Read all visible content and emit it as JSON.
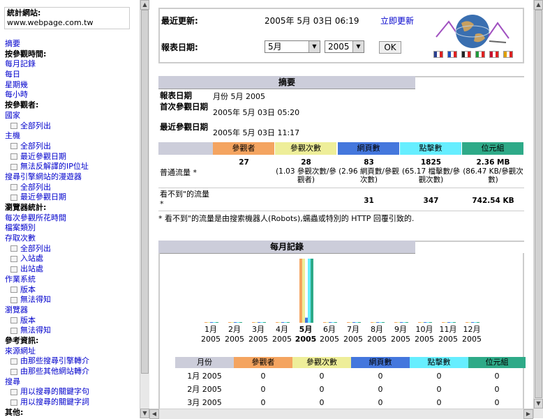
{
  "left": {
    "title": "統計網站:",
    "site": "www.webpage.com.tw",
    "nav": [
      {
        "type": "link",
        "label": "摘要",
        "name": "nav-summary"
      },
      {
        "type": "head",
        "label": "按參觀時間:",
        "name": "nav-head-time"
      },
      {
        "type": "link",
        "label": "每月記錄",
        "name": "nav-monthly"
      },
      {
        "type": "link",
        "label": "每日",
        "name": "nav-daily"
      },
      {
        "type": "link",
        "label": "星期幾",
        "name": "nav-weekday"
      },
      {
        "type": "link",
        "label": "每小時",
        "name": "nav-hourly"
      },
      {
        "type": "head",
        "label": "按參觀者:",
        "name": "nav-head-visitors"
      },
      {
        "type": "link",
        "label": "國家",
        "name": "nav-country"
      },
      {
        "type": "sub",
        "label": "全部列出",
        "name": "nav-country-all"
      },
      {
        "type": "link",
        "label": "主機",
        "name": "nav-hosts"
      },
      {
        "type": "sub",
        "label": "全部列出",
        "name": "nav-hosts-all"
      },
      {
        "type": "sub",
        "label": "最近參觀日期",
        "name": "nav-hosts-last"
      },
      {
        "type": "sub",
        "label": "無法反解譯的IP位址",
        "name": "nav-hosts-unresolved"
      },
      {
        "type": "link",
        "label": "搜尋引擎網站的漫遊器",
        "name": "nav-robots"
      },
      {
        "type": "sub",
        "label": "全部列出",
        "name": "nav-robots-all"
      },
      {
        "type": "sub",
        "label": "最近參觀日期",
        "name": "nav-robots-last"
      },
      {
        "type": "head",
        "label": "瀏覽器統計:",
        "name": "nav-head-browse"
      },
      {
        "type": "link",
        "label": "每次參觀所花時間",
        "name": "nav-duration"
      },
      {
        "type": "link",
        "label": "檔案類別",
        "name": "nav-filetypes"
      },
      {
        "type": "link",
        "label": "存取次數",
        "name": "nav-access"
      },
      {
        "type": "sub",
        "label": "全部列出",
        "name": "nav-access-all"
      },
      {
        "type": "sub",
        "label": "入站處",
        "name": "nav-entry"
      },
      {
        "type": "sub",
        "label": "出站處",
        "name": "nav-exit"
      },
      {
        "type": "link",
        "label": "作業系統",
        "name": "nav-os"
      },
      {
        "type": "sub",
        "label": "版本",
        "name": "nav-os-version"
      },
      {
        "type": "sub",
        "label": "無法得知",
        "name": "nav-os-unknown"
      },
      {
        "type": "link",
        "label": "瀏覽器",
        "name": "nav-browser"
      },
      {
        "type": "sub",
        "label": "版本",
        "name": "nav-browser-version"
      },
      {
        "type": "sub",
        "label": "無法得知",
        "name": "nav-browser-unknown"
      },
      {
        "type": "head",
        "label": "參考資訊:",
        "name": "nav-head-refs"
      },
      {
        "type": "link",
        "label": "來源網址",
        "name": "nav-referrer"
      },
      {
        "type": "sub",
        "label": "由那些搜尋引擎轉介",
        "name": "nav-ref-engines"
      },
      {
        "type": "sub",
        "label": "由那些其他網站轉介",
        "name": "nav-ref-sites"
      },
      {
        "type": "link",
        "label": "搜尋",
        "name": "nav-search"
      },
      {
        "type": "sub",
        "label": "用以搜尋的關鍵字句",
        "name": "nav-keyphrases"
      },
      {
        "type": "sub",
        "label": "用以搜尋的關鍵字詞",
        "name": "nav-keywords"
      },
      {
        "type": "head",
        "label": "其他:",
        "name": "nav-head-other"
      }
    ]
  },
  "top": {
    "last_update_label": "最近更新:",
    "last_update_value": "2005年 5月 03日 06:19",
    "update_now": "立即更新",
    "report_date_label": "報表日期:",
    "month_select": "5月",
    "year_select": "2005",
    "ok": "OK"
  },
  "flags": [
    {
      "name": "flag-uk-icon",
      "color": "#2a3f8f"
    },
    {
      "name": "flag-fr-icon",
      "color": "#1d4fbf"
    },
    {
      "name": "flag-de-icon",
      "color": "#222222"
    },
    {
      "name": "flag-it-icon",
      "color": "#1e9a3a"
    },
    {
      "name": "flag-nl-icon",
      "color": "#c8102e"
    },
    {
      "name": "flag-es-icon",
      "color": "#e0a000"
    }
  ],
  "summary": {
    "title": "摘要",
    "report_date_label": "報表日期",
    "report_date_value": "月份 5月 2005",
    "first_visit_label": "首次參觀日期",
    "first_visit_value": "2005年 5月 03日 05:20",
    "last_visit_label": "最近參觀日期",
    "last_visit_value": "2005年 5月 03日 11:17",
    "columns": [
      {
        "label": "參觀者",
        "color": "#f4a460"
      },
      {
        "label": "參觀次數",
        "color": "#eeee99"
      },
      {
        "label": "網頁數",
        "color": "#4477dd"
      },
      {
        "label": "點擊數",
        "color": "#66eeff"
      },
      {
        "label": "位元組",
        "color": "#2eaa88"
      }
    ],
    "traffic_label": "普通流量 *",
    "traffic": [
      {
        "main": "27",
        "sub": ""
      },
      {
        "main": "28",
        "sub": "(1.03 參觀次數/參觀者)"
      },
      {
        "main": "83",
        "sub": "(2.96 網頁數/參觀次數)"
      },
      {
        "main": "1825",
        "sub": "(65.17 檔擊數/參觀次數)"
      },
      {
        "main": "2.36 MB",
        "sub": "(86.47 KB/參觀次數)"
      }
    ],
    "unseen_label": "看不到\"的流量 *",
    "unseen": [
      "31",
      "347",
      "742.54 KB"
    ],
    "footnote": "* 看不到\"的流量是由搜索機器人(Robots),蠕蟲或特別的 HTTP 回覆引致的."
  },
  "monthly": {
    "title": "每月記錄",
    "months": [
      {
        "m": "1月",
        "y": "2005",
        "current": false
      },
      {
        "m": "2月",
        "y": "2005",
        "current": false
      },
      {
        "m": "3月",
        "y": "2005",
        "current": false
      },
      {
        "m": "4月",
        "y": "2005",
        "current": false
      },
      {
        "m": "5月",
        "y": "2005",
        "current": true
      },
      {
        "m": "6月",
        "y": "2005",
        "current": false
      },
      {
        "m": "7月",
        "y": "2005",
        "current": false
      },
      {
        "m": "8月",
        "y": "2005",
        "current": false
      },
      {
        "m": "9月",
        "y": "2005",
        "current": false
      },
      {
        "m": "10月",
        "y": "2005",
        "current": false
      },
      {
        "m": "11月",
        "y": "2005",
        "current": false
      },
      {
        "m": "12月",
        "y": "2005",
        "current": false
      }
    ],
    "table_headers": [
      "月份",
      "參觀者",
      "參觀次數",
      "網頁數",
      "點擊數",
      "位元組"
    ],
    "rows": [
      {
        "month": "1月 2005",
        "vals": [
          "0",
          "0",
          "0",
          "0",
          "0"
        ]
      },
      {
        "month": "2月 2005",
        "vals": [
          "0",
          "0",
          "0",
          "0",
          "0"
        ]
      },
      {
        "month": "3月 2005",
        "vals": [
          "0",
          "0",
          "0",
          "0",
          "0"
        ]
      }
    ]
  },
  "chart_data": {
    "type": "bar",
    "categories": [
      "1月 2005",
      "2月 2005",
      "3月 2005",
      "4月 2005",
      "5月 2005",
      "6月 2005",
      "7月 2005",
      "8月 2005",
      "9月 2005",
      "10月 2005",
      "11月 2005",
      "12月 2005"
    ],
    "series": [
      {
        "name": "參觀者",
        "values": [
          0,
          0,
          0,
          0,
          27,
          0,
          0,
          0,
          0,
          0,
          0,
          0
        ]
      },
      {
        "name": "參觀次數",
        "values": [
          0,
          0,
          0,
          0,
          28,
          0,
          0,
          0,
          0,
          0,
          0,
          0
        ]
      },
      {
        "name": "網頁數",
        "values": [
          0,
          0,
          0,
          0,
          83,
          0,
          0,
          0,
          0,
          0,
          0,
          0
        ]
      },
      {
        "name": "點擊數",
        "values": [
          0,
          0,
          0,
          0,
          1825,
          0,
          0,
          0,
          0,
          0,
          0,
          0
        ]
      },
      {
        "name": "位元組",
        "values": [
          0,
          0,
          0,
          0,
          2.36,
          0,
          0,
          0,
          0,
          0,
          0,
          0
        ]
      }
    ]
  }
}
